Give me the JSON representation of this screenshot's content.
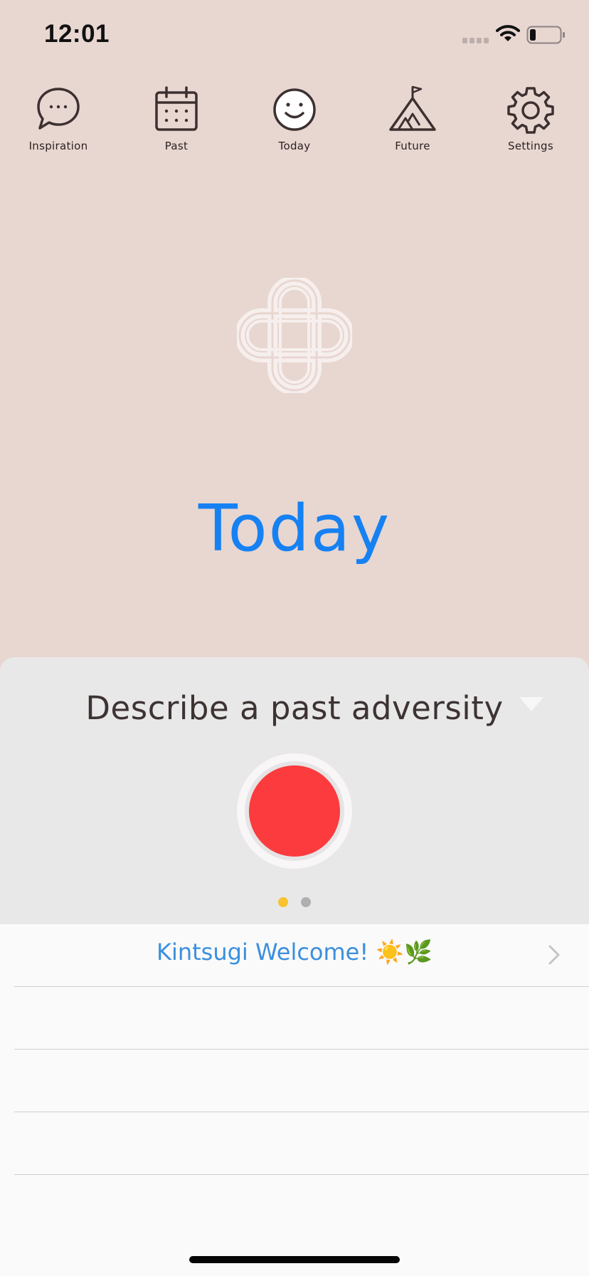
{
  "status_bar": {
    "time": "12:01"
  },
  "nav": {
    "items": [
      {
        "label": "Inspiration",
        "icon": "speech-bubble-icon"
      },
      {
        "label": "Past",
        "icon": "calendar-icon"
      },
      {
        "label": "Today",
        "icon": "smiley-icon"
      },
      {
        "label": "Future",
        "icon": "mountain-flag-icon"
      },
      {
        "label": "Settings",
        "icon": "gear-icon"
      }
    ]
  },
  "hero": {
    "logo_icon": "knot-logo",
    "title": "Today"
  },
  "sheet": {
    "prompt": "Describe a past adversity",
    "dropdown_icon": "chevron-down-icon",
    "record_icon": "record-button",
    "pager": {
      "count": 2,
      "active": 0
    }
  },
  "list": {
    "rows": [
      {
        "title": "Kintsugi Welcome! ☀️🌿"
      },
      {
        "title": ""
      },
      {
        "title": ""
      },
      {
        "title": ""
      }
    ]
  },
  "colors": {
    "background": "#e8d6d1",
    "accent_blue": "#1681f2",
    "record_red": "#fb3b3e",
    "pager_active": "#f8c230",
    "pager_inactive": "#b0aeae",
    "icon_dark": "#3c3030"
  }
}
